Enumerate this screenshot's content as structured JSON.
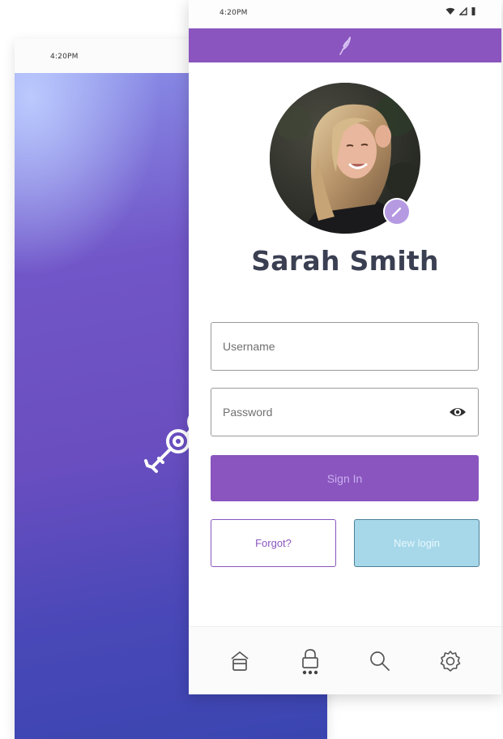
{
  "back_screen": {
    "status_time": "4:20PM"
  },
  "front_screen": {
    "status_time": "4:20PM",
    "profile": {
      "name": "Sarah Smith"
    },
    "form": {
      "username_placeholder": "Username",
      "password_placeholder": "Password"
    },
    "buttons": {
      "sign_in": "Sign In",
      "forgot": "Forgot?",
      "new_login": "New login"
    },
    "bottom_nav": [
      {
        "icon": "home-icon"
      },
      {
        "icon": "lock-icon"
      },
      {
        "icon": "search-icon"
      },
      {
        "icon": "settings-icon"
      }
    ]
  },
  "colors": {
    "primary_purple": "#8a55be",
    "light_blue": "#a6d8ea",
    "name_text": "#3b3f52"
  }
}
